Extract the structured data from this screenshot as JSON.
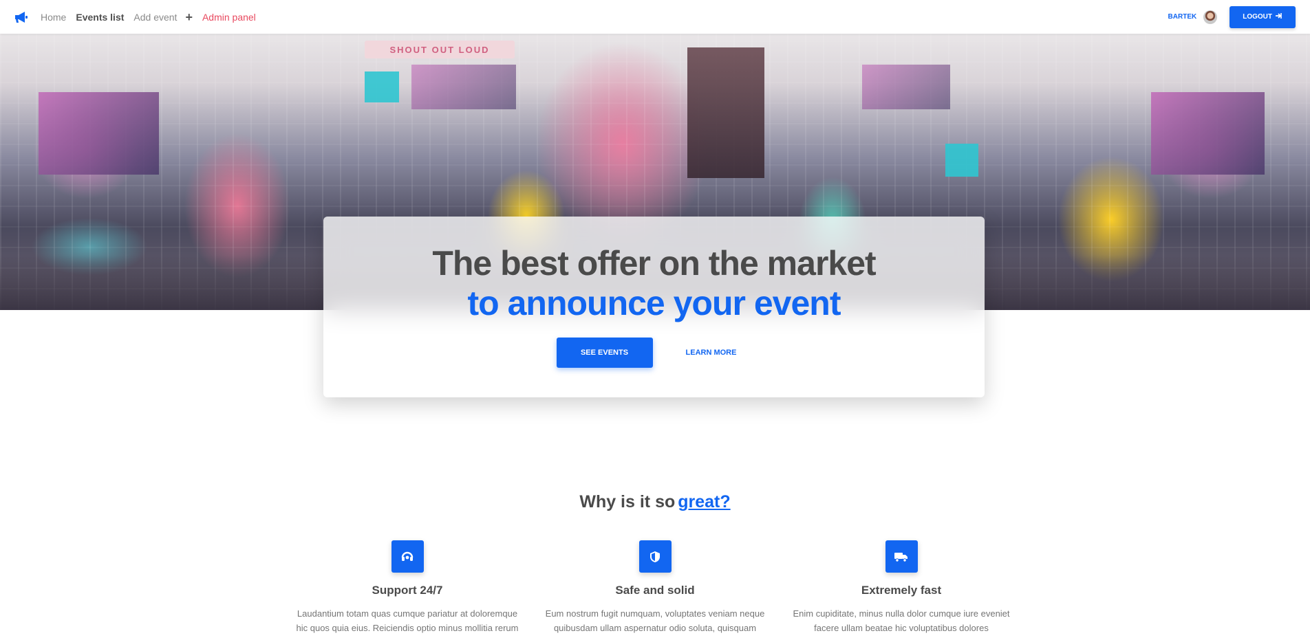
{
  "navbar": {
    "brand_icon": "megaphone-icon",
    "links": {
      "home": "Home",
      "events_list": "Events list",
      "add_event": "Add event",
      "admin_panel": "Admin panel"
    },
    "user": {
      "name": "BARTEK"
    },
    "logout_label": "LOGOUT"
  },
  "hero": {
    "sign_text": "SHOUT OUT LOUD",
    "title_line_1": "The best offer on the market",
    "title_line_2": "to announce your event",
    "primary_button": "SEE EVENTS",
    "secondary_button": "LEARN MORE"
  },
  "features_section": {
    "title_prefix": "Why is it so",
    "title_highlight": "great?",
    "items": [
      {
        "icon": "headset-icon",
        "title": "Support 24/7",
        "text": "Laudantium totam quas cumque pariatur at doloremque hic quos quia eius. Reiciendis optio minus mollitia rerum"
      },
      {
        "icon": "shield-icon",
        "title": "Safe and solid",
        "text": "Eum nostrum fugit numquam, voluptates veniam neque quibusdam ullam aspernatur odio soluta, quisquam"
      },
      {
        "icon": "truck-icon",
        "title": "Extremely fast",
        "text": "Enim cupiditate, minus nulla dolor cumque iure eveniet facere ullam beatae hic voluptatibus dolores"
      }
    ]
  },
  "colors": {
    "primary": "#1266f1",
    "admin": "#e8485e",
    "heading": "#4a4a4a"
  }
}
